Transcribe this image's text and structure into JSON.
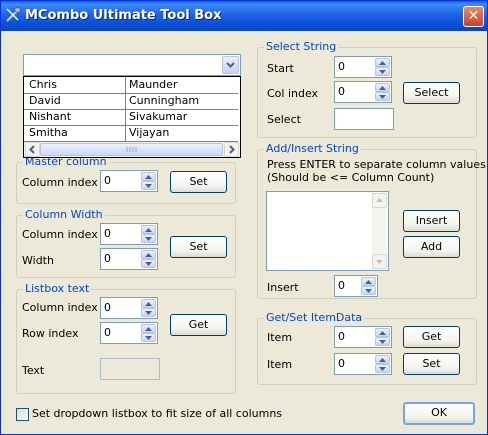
{
  "window": {
    "title": "MCombo Ultimate Tool Box",
    "close_symbol": "✕"
  },
  "combo": {
    "value": "",
    "rows": [
      [
        "Chris",
        "Maunder"
      ],
      [
        "David",
        "Cunningham"
      ],
      [
        "Nishant",
        "Sivakumar"
      ],
      [
        "Smitha",
        "Vijayan"
      ]
    ]
  },
  "master_column": {
    "title": "Master column",
    "label": "Column index",
    "value": "0",
    "button": "Set"
  },
  "column_width": {
    "title": "Column Width",
    "column_index_label": "Column index",
    "column_index_value": "0",
    "width_label": "Width",
    "width_value": "0",
    "button": "Set"
  },
  "listbox_text": {
    "title": "Listbox text",
    "column_index_label": "Column index",
    "column_index_value": "0",
    "row_index_label": "Row index",
    "row_index_value": "0",
    "button": "Get",
    "text_label": "Text",
    "text_value": ""
  },
  "select_string": {
    "title": "Select String",
    "start_label": "Start",
    "start_value": "0",
    "col_index_label": "Col index",
    "col_index_value": "0",
    "button": "Select",
    "select_label": "Select",
    "select_value": ""
  },
  "add_insert": {
    "title": "Add/Insert String",
    "hint_line1": "Press  ENTER to separate column values",
    "hint_line2": "(Should be <= Column Count)",
    "insert_button": "Insert",
    "add_button": "Add",
    "insert_label": "Insert",
    "insert_value": "0"
  },
  "get_set_itemdata": {
    "title": "Get/Set ItemData",
    "item1_label": "Item",
    "item1_value": "0",
    "get_button": "Get",
    "item2_label": "Item",
    "item2_value": "0",
    "set_button": "Set"
  },
  "fit_checkbox": {
    "label": "Set dropdown listbox to fit size of all columns",
    "checked": false
  },
  "ok_button": "OK",
  "colors": {
    "accent": "#0046d5",
    "titlebar": "#0a5fdd",
    "face": "#ece9d8",
    "close": "#d5512f"
  }
}
